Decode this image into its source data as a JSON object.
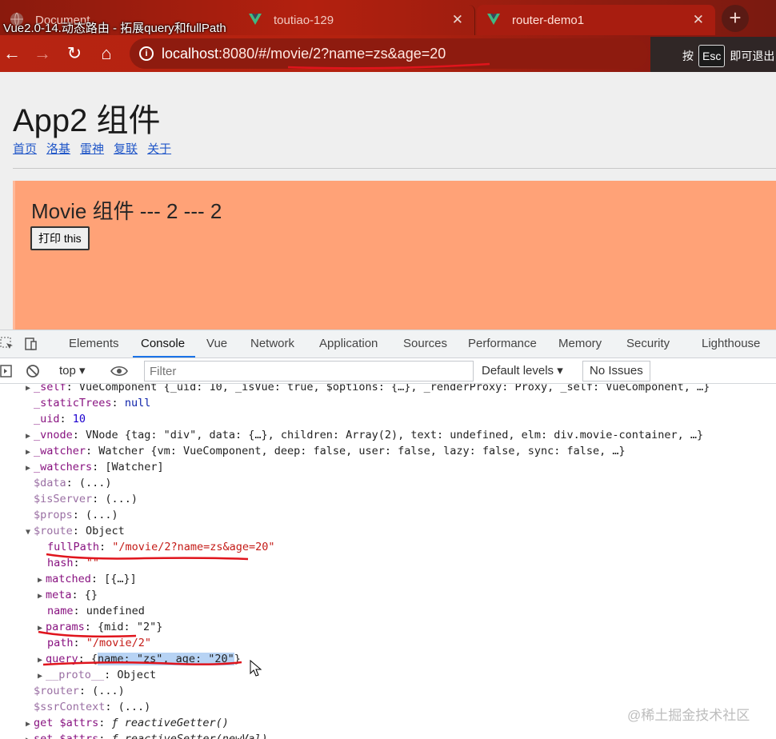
{
  "video_title": "Vue2.0-14.动态路由 - 拓展query和fullPath",
  "tabs": [
    {
      "label": "Document",
      "icon": "globe-icon"
    },
    {
      "label": "toutiao-129",
      "icon": "vue-icon"
    },
    {
      "label": "router-demo1",
      "icon": "vue-icon"
    }
  ],
  "url": {
    "host": "localhost",
    "rest": ":8080/#/movie/2?name=zs&age=20"
  },
  "esc_hint": {
    "before": "按",
    "key": "Esc",
    "after": "即可退出"
  },
  "page": {
    "app_title": "App2 组件",
    "nav_links": [
      "首页",
      "洛基",
      "雷神",
      "复联",
      "关于"
    ],
    "movie_title": "Movie 组件 --- 2 --- 2",
    "print_button": "打印 this"
  },
  "devtools": {
    "tabs": [
      "Elements",
      "Console",
      "Vue",
      "Network",
      "Application",
      "Sources",
      "Performance",
      "Memory",
      "Security",
      "Lighthouse"
    ],
    "active_tab": "Console",
    "context": "top",
    "filter_placeholder": "Filter",
    "levels": "Default levels",
    "issues": "No Issues"
  },
  "console": {
    "l0": {
      "key": "_self",
      "val": "VueComponent {_uid: 10, _isVue: true, $options: {…}, _renderProxy: Proxy, _self: VueComponent, …}"
    },
    "l1": {
      "key": "_staticTrees",
      "val": "null"
    },
    "l2": {
      "key": "_uid",
      "val": "10"
    },
    "l3": {
      "key": "_vnode",
      "val": "VNode {tag: \"div\", data: {…}, children: Array(2), text: undefined, elm: div.movie-container, …}"
    },
    "l4": {
      "key": "_watcher",
      "val": "Watcher {vm: VueComponent, deep: false, user: false, lazy: false, sync: false, …}"
    },
    "l5": {
      "key": "_watchers",
      "val": "[Watcher]"
    },
    "l6": {
      "key": "$data",
      "val": "(...)"
    },
    "l7": {
      "key": "$isServer",
      "val": "(...)"
    },
    "l8": {
      "key": "$props",
      "val": "(...)"
    },
    "l9": {
      "key": "$route",
      "val": "Object"
    },
    "l10": {
      "key": "fullPath",
      "val": "\"/movie/2?name=zs&age=20\""
    },
    "l11": {
      "key": "hash",
      "val": "\"\""
    },
    "l12": {
      "key": "matched",
      "val": "[{…}]"
    },
    "l13": {
      "key": "meta",
      "val": "{}"
    },
    "l14": {
      "key": "name",
      "val": "undefined"
    },
    "l15": {
      "key": "params",
      "val": "{mid: \"2\"}"
    },
    "l16": {
      "key": "path",
      "val": "\"/movie/2\""
    },
    "l17": {
      "key": "query",
      "val_open": "{",
      "val_hl": "name: \"zs\", age: \"20\"",
      "val_close": "}"
    },
    "l18": {
      "key": "__proto__",
      "val": "Object"
    },
    "l19": {
      "key": "$router",
      "val": "(...)"
    },
    "l20": {
      "key": "$ssrContext",
      "val": "(...)"
    },
    "l21": {
      "key": "get $attrs",
      "val": "ƒ reactiveGetter()"
    },
    "l22": {
      "key": "set $attrs",
      "val": "ƒ reactiveSetter(newVal)"
    }
  },
  "watermark": "@稀土掘金技术社区",
  "colors": {
    "browser_accent": "#b3200f",
    "movie_bg": "#ffa277",
    "annotation": "#e0141c"
  }
}
